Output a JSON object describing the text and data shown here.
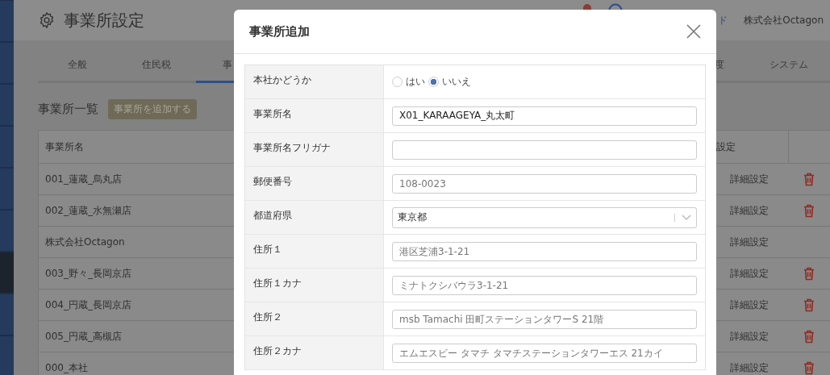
{
  "sidebar": {
    "items": [
      {
        "selected": false
      },
      {
        "selected": false
      },
      {
        "selected": false
      },
      {
        "selected": false
      },
      {
        "selected": false
      },
      {
        "selected": false
      },
      {
        "selected": true
      },
      {
        "selected": false
      },
      {
        "selected": false
      }
    ]
  },
  "header": {
    "title": "事業所設定",
    "link": "ド",
    "company": "株式会社Octagon"
  },
  "tabs": [
    {
      "label": "全般",
      "selected": false
    },
    {
      "label": "住民税",
      "selected": false
    },
    {
      "label": "事",
      "selected": true
    },
    {
      "label": "度",
      "selected": false
    },
    {
      "label": "システム",
      "selected": false
    }
  ],
  "list": {
    "title": "事業所一覧",
    "add_button": "事業所を追加する"
  },
  "table": {
    "columns": [
      "事業所名",
      "設定"
    ],
    "rows": [
      {
        "name": "001_蓮蔵_烏丸店",
        "action": "詳細設定",
        "deletable": true
      },
      {
        "name": "002_蓮蔵_水無瀬店",
        "action": "詳細設定",
        "deletable": true
      },
      {
        "name": "株式会社Octagon",
        "action": "詳細設定",
        "deletable": false
      },
      {
        "name": "003_野々_長岡京店",
        "action": "詳細設定",
        "deletable": true
      },
      {
        "name": "004_円蔵_長岡京店",
        "action": "詳細設定",
        "deletable": true
      },
      {
        "name": "005_円蔵_高槻店",
        "action": "詳細設定",
        "deletable": true
      },
      {
        "name": "000_本社",
        "action": "詳細設定",
        "deletable": true
      }
    ]
  },
  "modal": {
    "title": "事業所追加",
    "fields": [
      {
        "label": "本社かどうか",
        "kind": "radio",
        "options": [
          {
            "label": "はい",
            "selected": false
          },
          {
            "label": "いいえ",
            "selected": true
          }
        ]
      },
      {
        "label": "事業所名",
        "kind": "text",
        "value": "X01_KARAAGEYA_丸太町"
      },
      {
        "label": "事業所名フリガナ",
        "kind": "text"
      },
      {
        "label": "郵便番号",
        "kind": "text",
        "placeholder": "108-0023"
      },
      {
        "label": "都道府県",
        "kind": "select",
        "value": "東京都"
      },
      {
        "label": "住所１",
        "kind": "text",
        "placeholder": "港区芝浦3-1-21"
      },
      {
        "label": "住所１カナ",
        "kind": "text",
        "placeholder": "ミナトクシバウラ3-1-21"
      },
      {
        "label": "住所２",
        "kind": "text",
        "placeholder": "msb Tamachi 田町ステーションタワーS 21階"
      },
      {
        "label": "住所２カナ",
        "kind": "text",
        "placeholder": "エムエスビー タマチ タマチステーションタワーエス 21カイ"
      }
    ]
  }
}
